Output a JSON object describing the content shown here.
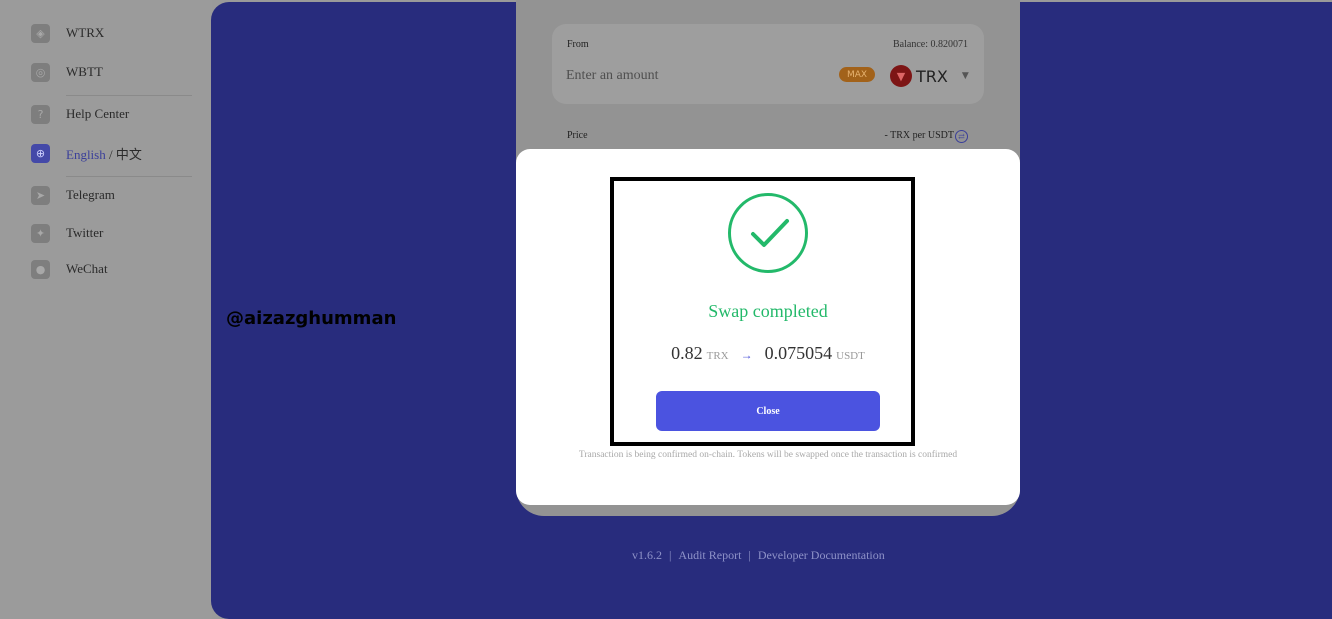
{
  "sidebar": {
    "items": [
      {
        "label": "WTRX",
        "icon": "wtrx-token-icon"
      },
      {
        "label": "WBTT",
        "icon": "wbtt-token-icon"
      },
      {
        "label": "Help Center",
        "icon": "help-icon"
      },
      {
        "label": "English",
        "label_suffix": "中文",
        "separator": " / ",
        "icon": "globe-icon"
      },
      {
        "label": "Telegram",
        "icon": "telegram-icon"
      },
      {
        "label": "Twitter",
        "icon": "twitter-icon"
      },
      {
        "label": "WeChat",
        "icon": "wechat-icon"
      }
    ]
  },
  "watermark": "@aizazghumman",
  "swap": {
    "from_label": "From",
    "balance": "Balance: 0.820071",
    "amount_placeholder": "Enter an amount",
    "max_label": "MAX",
    "token": "TRX",
    "price_label": "Price",
    "price_value": "- TRX per USDT"
  },
  "modal": {
    "title": "Swap completed",
    "from_amount": "0.82",
    "from_symbol": "TRX",
    "arrow": "→",
    "to_amount": "0.075054",
    "to_symbol": "USDT",
    "close_label": "Close",
    "note": "Transaction is being confirmed on-chain. Tokens will be swapped once the transaction is confirmed"
  },
  "footer": {
    "version": "v1.6.2",
    "audit": "Audit Report",
    "docs": "Developer Documentation",
    "separator": "|"
  },
  "colors": {
    "accent": "#4b53e0",
    "success": "#23b96a",
    "backdrop": "#282c7d"
  }
}
